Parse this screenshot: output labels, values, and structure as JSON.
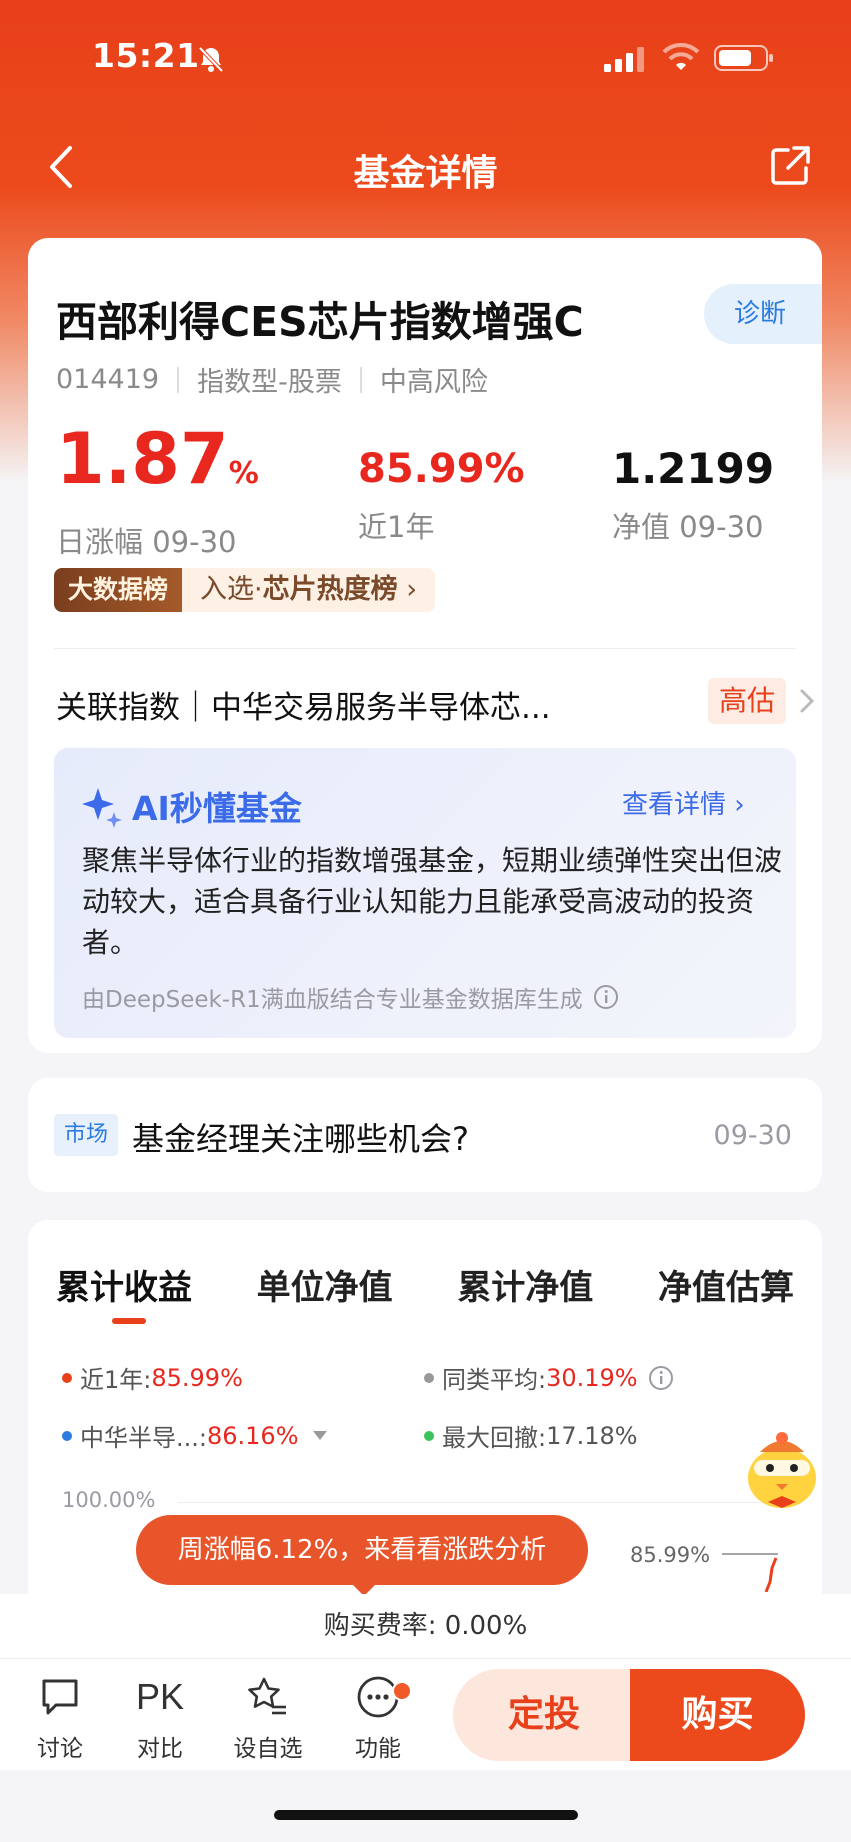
{
  "status": {
    "time": "15:21"
  },
  "nav": {
    "title": "基金详情"
  },
  "fund": {
    "name": "西部利得CES芯片指数增强C",
    "code": "014419",
    "type": "指数型-股票",
    "risk": "中高风险",
    "diagnose_label": "诊断",
    "daily_change": "1.87",
    "daily_change_unit": "%",
    "daily_change_label": "日涨幅 09-30",
    "year_return": "85.99%",
    "year_return_label": "近1年",
    "nav_value": "1.2199",
    "nav_label": "净值 09-30"
  },
  "rank": {
    "badge": "大数据榜",
    "text_prefix": "入选·",
    "text_bold": "芯片热度榜"
  },
  "index": {
    "text": "关联指数｜中华交易服务半导体芯...",
    "badge": "高估"
  },
  "ai": {
    "title": "AI秒懂基金",
    "link": "查看详情",
    "body": "聚焦半导体行业的指数增强基金，短期业绩弹性突出但波动较大，适合具备行业认知能力且能承受高波动的投资者。",
    "footer": "由DeepSeek-R1满血版结合专业基金数据库生成"
  },
  "market": {
    "tag": "市场",
    "title": "基金经理关注哪些机会?",
    "date": "09-30"
  },
  "chart_tabs": [
    "累计收益",
    "单位净值",
    "累计净值",
    "净值估算"
  ],
  "legend": [
    {
      "label": "近1年:",
      "value": "85.99%",
      "color": "#e8401a"
    },
    {
      "label": "同类平均:",
      "value": "30.19%",
      "color": "#999999"
    },
    {
      "label": "中华半导...:",
      "value": "86.16%",
      "color": "#2b7be0"
    },
    {
      "label": "最大回撤:",
      "value": "17.18%",
      "color": "#3cc25a"
    }
  ],
  "chart": {
    "axis_top": "100.00%",
    "end_value": "85.99%",
    "tooltip": "周涨幅6.12%，来看看涨跌分析"
  },
  "fee": {
    "text": "购买费率: 0.00%"
  },
  "bottom": {
    "discuss": "讨论",
    "pk_glyph": "PK",
    "compare": "对比",
    "watchlist": "设自选",
    "functions": "功能",
    "dingtou": "定投",
    "buy": "购买"
  },
  "colors": {
    "brand": "#e8401a",
    "up": "#e8281e",
    "ai_blue": "#3b6be8"
  }
}
